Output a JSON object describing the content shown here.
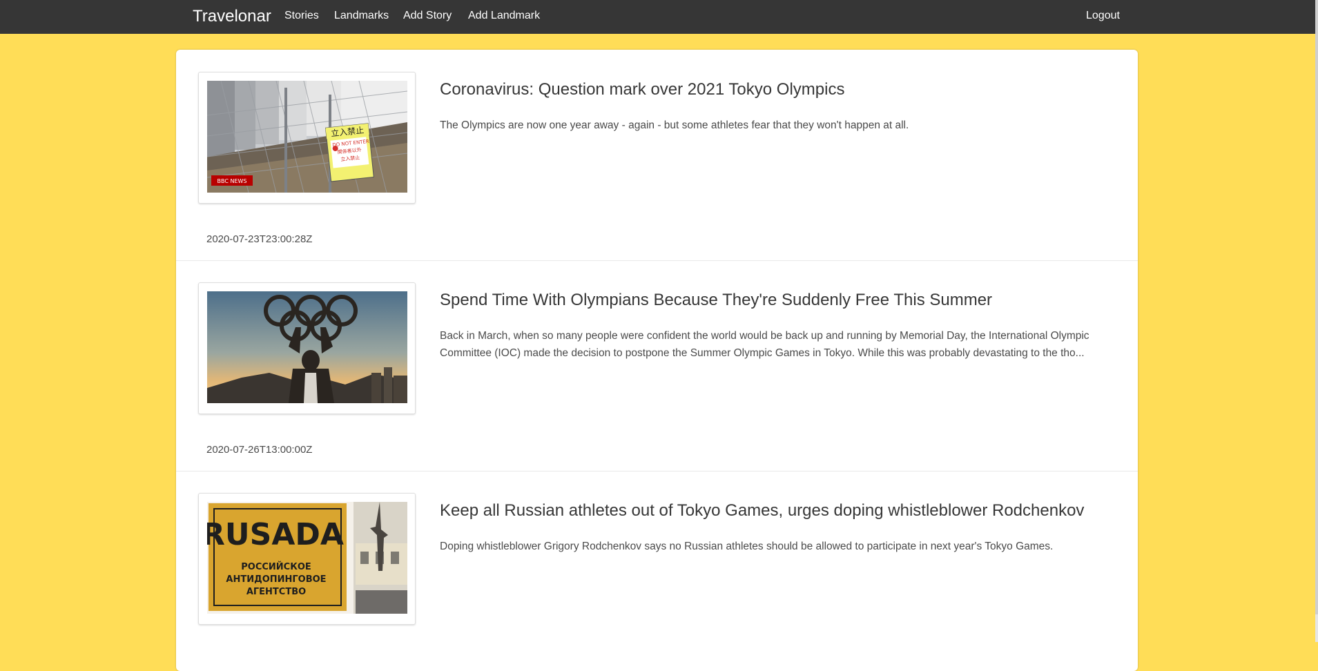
{
  "nav": {
    "brand": "Travelonar",
    "links": [
      "Stories",
      "Landmarks",
      "Add Story",
      "Add Landmark"
    ],
    "logout": "Logout"
  },
  "stories": [
    {
      "title": "Coronavirus: Question mark over 2021 Tokyo Olympics",
      "description": "The Olympics are now one year away - again - but some athletes fear that they won't happen at all.",
      "date": "2020-07-23T23:00:28Z",
      "image": {
        "sign_top": "立入禁止",
        "sign_line1": "DO NOT ENTER",
        "sign_line2": "関係者以外",
        "sign_line3": "立入禁止",
        "badge": "BBC NEWS"
      }
    },
    {
      "title": "Spend Time With Olympians Because They're Suddenly Free This Summer",
      "description": "Back in March, when so many people were confident the world would be back up and running by Memorial Day, the International Olympic Committee (IOC) made the decision to postpone the Summer Olympic Games in Tokyo. While this was probably devastating to the tho...",
      "date": "2020-07-26T13:00:00Z"
    },
    {
      "title": "Keep all Russian athletes out of Tokyo Games, urges doping whistleblower Rodchenkov",
      "description": "Doping whistleblower Grigory Rodchenkov says no Russian athletes should be allowed to participate in next year's Tokyo Games.",
      "date": "",
      "image": {
        "sign_logo": "RUSADA",
        "sign_line1": "РОССИЙСКОЕ",
        "sign_line2": "АНТИДОПИНГОВОЕ",
        "sign_line3": "АГЕНТСТВО"
      }
    }
  ]
}
